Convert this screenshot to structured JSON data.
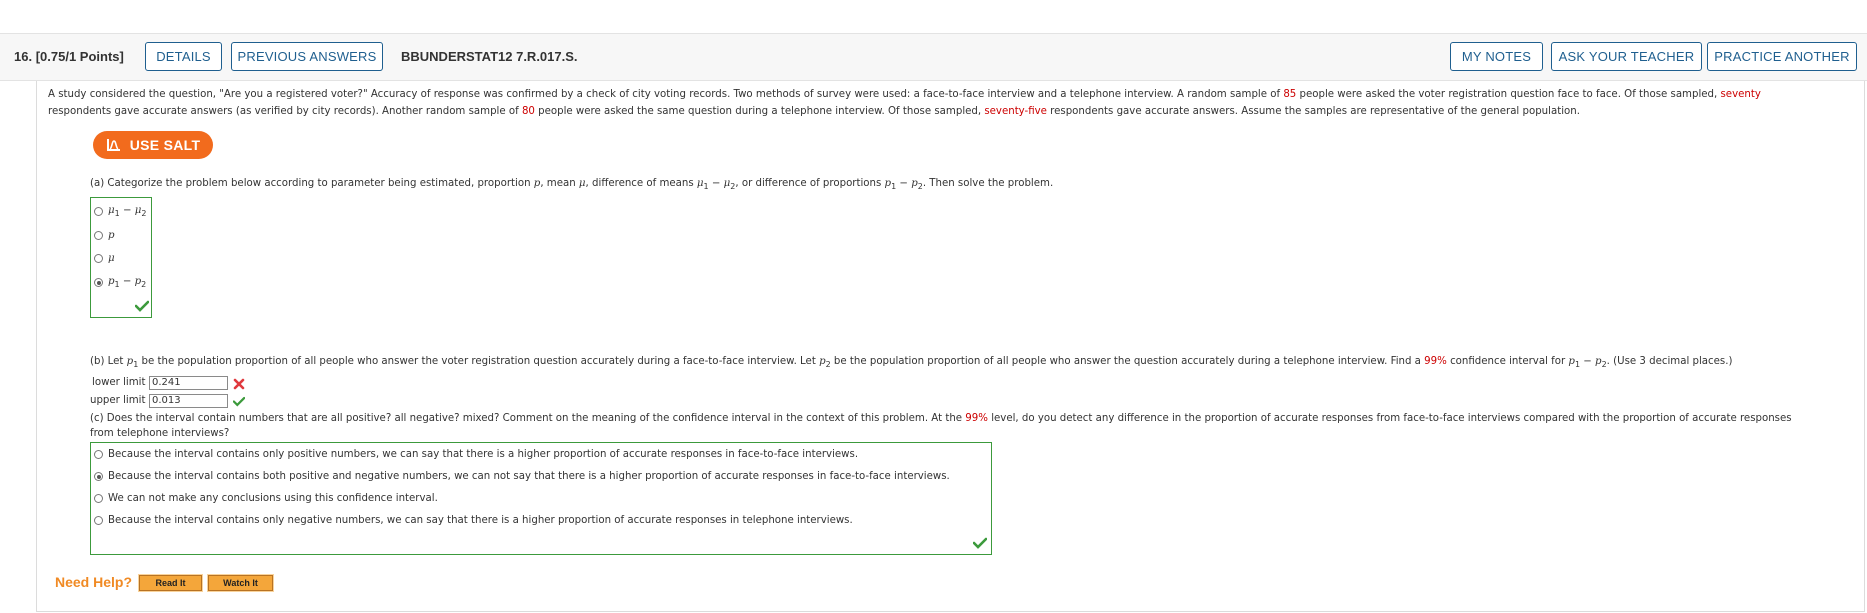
{
  "header": {
    "question_number": "16.",
    "points": "[0.75/1 Points]",
    "details_label": "DETAILS",
    "previous_answers_label": "PREVIOUS ANSWERS",
    "problem_code": "BBUNDERSTAT12 7.R.017.S.",
    "my_notes_label": "MY NOTES",
    "ask_teacher_label": "ASK YOUR TEACHER",
    "practice_another_label": "PRACTICE ANOTHER"
  },
  "prompt": {
    "line1_a": "A study considered the question, \"Are you a registered voter?\" Accuracy of response was confirmed by a check of city voting records. Two methods of survey were used: a face-to-face interview and a telephone interview. A random sample of ",
    "n1": "85",
    "line1_b": " people were asked the voter registration question face to face. Of those sampled, ",
    "x1_word": "seventy",
    "line2_a": "respondents gave accurate answers (as verified by city records). Another random sample of ",
    "n2": "80",
    "line2_b": " people were asked the same question during a telephone interview. Of those sampled, ",
    "x2_word": "seventy-five",
    "line2_c": " respondents gave accurate answers. Assume the samples are representative of the general population."
  },
  "salt": {
    "label": "USE SALT",
    "icon": "salt-icon"
  },
  "part_a": {
    "text_a": "(a) Categorize the problem below according to parameter being estimated, proportion ",
    "text_p": "p",
    "text_b": ", mean ",
    "text_mu": "μ",
    "text_c": ", difference of means ",
    "text_d": ", or difference of proportions ",
    "text_e": ". Then solve the problem.",
    "options": [
      {
        "label": "μ",
        "sub1": "1",
        "minus": " − ",
        "label2": "μ",
        "sub2": "2",
        "selected": false
      },
      {
        "label": "p",
        "selected": false
      },
      {
        "label": "μ",
        "selected": false
      },
      {
        "label": "p",
        "sub1": "1",
        "minus": " − ",
        "label2": "p",
        "sub2": "2",
        "selected": true
      }
    ],
    "status": "correct"
  },
  "part_b": {
    "text_a": "(b) Let ",
    "text_b": " be the population proportion of all people who answer the voter registration question accurately during a face-to-face interview. Let ",
    "text_c": " be the population proportion of all people who answer the question accurately during a telephone interview. Find a ",
    "confidence": "99%",
    "text_d": " confidence interval for ",
    "text_e": ". (Use 3 decimal places.)",
    "lower_label": "lower limit",
    "lower_value": "0.241",
    "lower_status": "incorrect",
    "upper_label": "upper limit",
    "upper_value": "0.013",
    "upper_status": "correct"
  },
  "part_c": {
    "text_a": "(c) Does the interval contain numbers that are all positive? all negative? mixed? Comment on the meaning of the confidence interval in the context of this problem. At the ",
    "level": "99%",
    "text_b": " level, do you detect any difference in the proportion of accurate responses from face-to-face interviews compared with the proportion of accurate responses",
    "text_c": "from telephone interviews?",
    "options": [
      {
        "label": "Because the interval contains only positive numbers, we can say that there is a higher proportion of accurate responses in face-to-face interviews.",
        "selected": false
      },
      {
        "label": "Because the interval contains both positive and negative numbers, we can not say that there is a higher proportion of accurate responses in face-to-face interviews.",
        "selected": true
      },
      {
        "label": "We can not make any conclusions using this confidence interval.",
        "selected": false
      },
      {
        "label": "Because the interval contains only negative numbers, we can say that there is a higher proportion of accurate responses in telephone interviews.",
        "selected": false
      }
    ],
    "status": "correct"
  },
  "help": {
    "label": "Need Help?",
    "read_it": "Read It",
    "watch_it": "Watch It"
  },
  "colors": {
    "accent_blue": "#1f5f8f",
    "highlight_red": "#cc0000",
    "salt_orange": "#f26b1d",
    "correct_green": "#3c9a3c",
    "incorrect_red": "#e0393e"
  }
}
